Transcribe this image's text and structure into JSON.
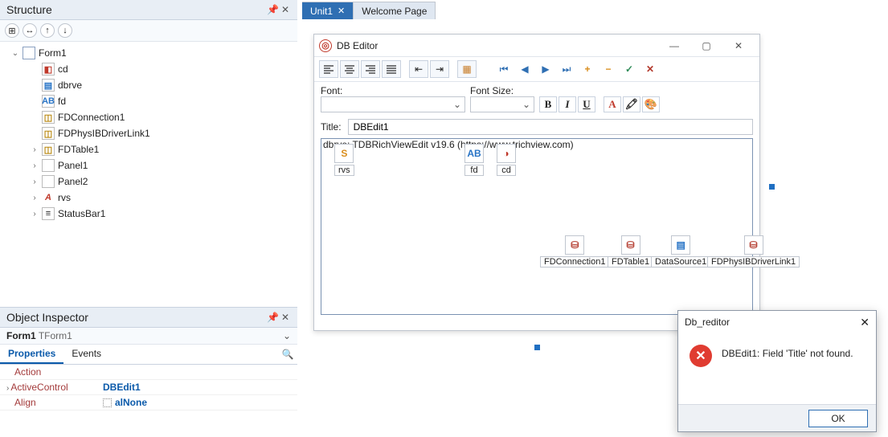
{
  "structure": {
    "title": "Structure",
    "tree": {
      "root": "Form1",
      "children": [
        {
          "name": "cd"
        },
        {
          "name": "dbrve"
        },
        {
          "name": "fd"
        },
        {
          "name": "FDConnection1"
        },
        {
          "name": "FDPhysIBDriverLink1"
        },
        {
          "name": "FDTable1",
          "expandable": true
        },
        {
          "name": "Panel1",
          "expandable": true
        },
        {
          "name": "Panel2",
          "expandable": true
        },
        {
          "name": "rvs",
          "expandable": true
        },
        {
          "name": "StatusBar1",
          "expandable": true
        }
      ]
    }
  },
  "objectInspector": {
    "title": "Object Inspector",
    "target": {
      "form": "Form1",
      "class": "TForm1"
    },
    "tabs": {
      "properties": "Properties",
      "events": "Events"
    },
    "props": {
      "Action": "",
      "ActiveControl": "DBEdit1",
      "Align": "alNone"
    }
  },
  "tabs": {
    "active": "Unit1",
    "other": "Welcome Page"
  },
  "form": {
    "caption": "DB Editor",
    "fontLabel": "Font:",
    "fontSizeLabel": "Font Size:",
    "titleLabel": "Title:",
    "titleValue": "DBEdit1",
    "designText": "dbrve: TDBRichViewEdit v19.6 (https://www.trichview.com)",
    "components": {
      "rvs": "rvs",
      "fd": "fd",
      "cd": "cd",
      "fdconn": "FDConnection1",
      "fdtable": "FDTable1",
      "datasource": "DataSource1",
      "fdphys": "FDPhysIBDriverLink1"
    },
    "fmt": {
      "b": "B",
      "i": "I",
      "u": "U"
    }
  },
  "error": {
    "title": "Db_reditor",
    "message": "DBEdit1: Field 'Title' not found.",
    "ok": "OK"
  }
}
